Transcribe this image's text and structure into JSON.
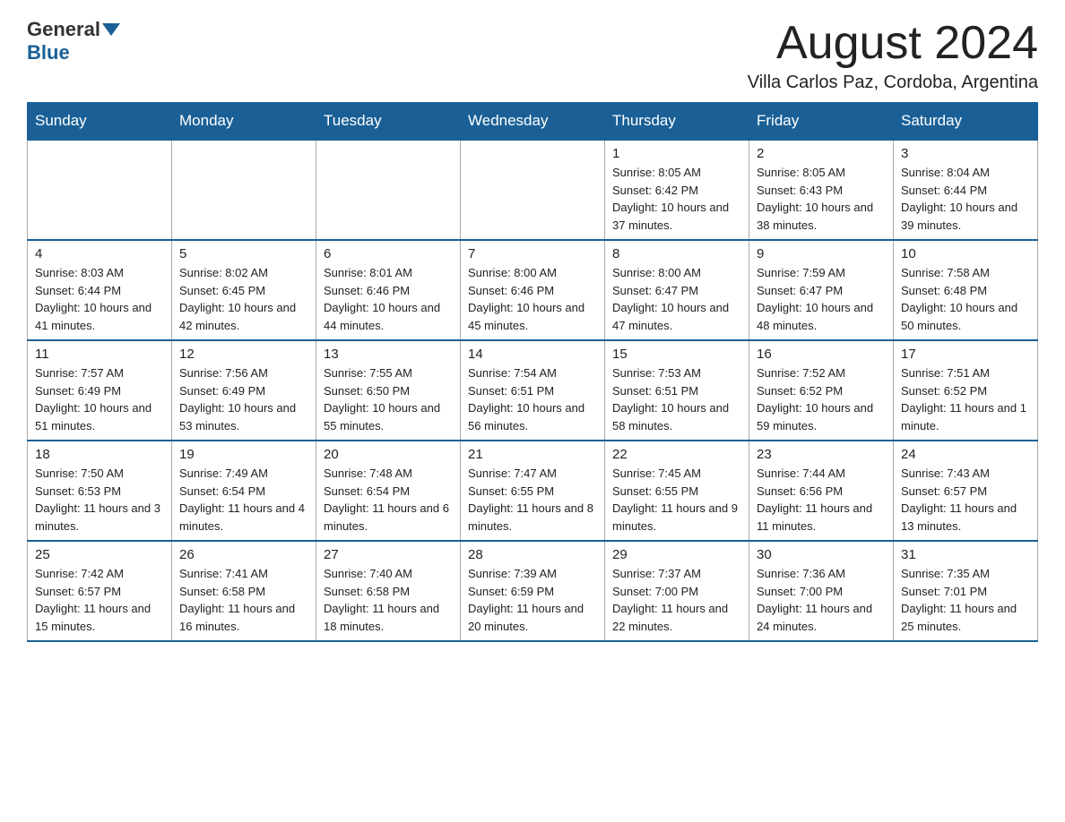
{
  "header": {
    "logo_general": "General",
    "logo_blue": "Blue",
    "month_title": "August 2024",
    "location": "Villa Carlos Paz, Cordoba, Argentina"
  },
  "days_of_week": [
    "Sunday",
    "Monday",
    "Tuesday",
    "Wednesday",
    "Thursday",
    "Friday",
    "Saturday"
  ],
  "weeks": [
    {
      "days": [
        {
          "num": "",
          "info": ""
        },
        {
          "num": "",
          "info": ""
        },
        {
          "num": "",
          "info": ""
        },
        {
          "num": "",
          "info": ""
        },
        {
          "num": "1",
          "info": "Sunrise: 8:05 AM\nSunset: 6:42 PM\nDaylight: 10 hours and 37 minutes."
        },
        {
          "num": "2",
          "info": "Sunrise: 8:05 AM\nSunset: 6:43 PM\nDaylight: 10 hours and 38 minutes."
        },
        {
          "num": "3",
          "info": "Sunrise: 8:04 AM\nSunset: 6:44 PM\nDaylight: 10 hours and 39 minutes."
        }
      ]
    },
    {
      "days": [
        {
          "num": "4",
          "info": "Sunrise: 8:03 AM\nSunset: 6:44 PM\nDaylight: 10 hours and 41 minutes."
        },
        {
          "num": "5",
          "info": "Sunrise: 8:02 AM\nSunset: 6:45 PM\nDaylight: 10 hours and 42 minutes."
        },
        {
          "num": "6",
          "info": "Sunrise: 8:01 AM\nSunset: 6:46 PM\nDaylight: 10 hours and 44 minutes."
        },
        {
          "num": "7",
          "info": "Sunrise: 8:00 AM\nSunset: 6:46 PM\nDaylight: 10 hours and 45 minutes."
        },
        {
          "num": "8",
          "info": "Sunrise: 8:00 AM\nSunset: 6:47 PM\nDaylight: 10 hours and 47 minutes."
        },
        {
          "num": "9",
          "info": "Sunrise: 7:59 AM\nSunset: 6:47 PM\nDaylight: 10 hours and 48 minutes."
        },
        {
          "num": "10",
          "info": "Sunrise: 7:58 AM\nSunset: 6:48 PM\nDaylight: 10 hours and 50 minutes."
        }
      ]
    },
    {
      "days": [
        {
          "num": "11",
          "info": "Sunrise: 7:57 AM\nSunset: 6:49 PM\nDaylight: 10 hours and 51 minutes."
        },
        {
          "num": "12",
          "info": "Sunrise: 7:56 AM\nSunset: 6:49 PM\nDaylight: 10 hours and 53 minutes."
        },
        {
          "num": "13",
          "info": "Sunrise: 7:55 AM\nSunset: 6:50 PM\nDaylight: 10 hours and 55 minutes."
        },
        {
          "num": "14",
          "info": "Sunrise: 7:54 AM\nSunset: 6:51 PM\nDaylight: 10 hours and 56 minutes."
        },
        {
          "num": "15",
          "info": "Sunrise: 7:53 AM\nSunset: 6:51 PM\nDaylight: 10 hours and 58 minutes."
        },
        {
          "num": "16",
          "info": "Sunrise: 7:52 AM\nSunset: 6:52 PM\nDaylight: 10 hours and 59 minutes."
        },
        {
          "num": "17",
          "info": "Sunrise: 7:51 AM\nSunset: 6:52 PM\nDaylight: 11 hours and 1 minute."
        }
      ]
    },
    {
      "days": [
        {
          "num": "18",
          "info": "Sunrise: 7:50 AM\nSunset: 6:53 PM\nDaylight: 11 hours and 3 minutes."
        },
        {
          "num": "19",
          "info": "Sunrise: 7:49 AM\nSunset: 6:54 PM\nDaylight: 11 hours and 4 minutes."
        },
        {
          "num": "20",
          "info": "Sunrise: 7:48 AM\nSunset: 6:54 PM\nDaylight: 11 hours and 6 minutes."
        },
        {
          "num": "21",
          "info": "Sunrise: 7:47 AM\nSunset: 6:55 PM\nDaylight: 11 hours and 8 minutes."
        },
        {
          "num": "22",
          "info": "Sunrise: 7:45 AM\nSunset: 6:55 PM\nDaylight: 11 hours and 9 minutes."
        },
        {
          "num": "23",
          "info": "Sunrise: 7:44 AM\nSunset: 6:56 PM\nDaylight: 11 hours and 11 minutes."
        },
        {
          "num": "24",
          "info": "Sunrise: 7:43 AM\nSunset: 6:57 PM\nDaylight: 11 hours and 13 minutes."
        }
      ]
    },
    {
      "days": [
        {
          "num": "25",
          "info": "Sunrise: 7:42 AM\nSunset: 6:57 PM\nDaylight: 11 hours and 15 minutes."
        },
        {
          "num": "26",
          "info": "Sunrise: 7:41 AM\nSunset: 6:58 PM\nDaylight: 11 hours and 16 minutes."
        },
        {
          "num": "27",
          "info": "Sunrise: 7:40 AM\nSunset: 6:58 PM\nDaylight: 11 hours and 18 minutes."
        },
        {
          "num": "28",
          "info": "Sunrise: 7:39 AM\nSunset: 6:59 PM\nDaylight: 11 hours and 20 minutes."
        },
        {
          "num": "29",
          "info": "Sunrise: 7:37 AM\nSunset: 7:00 PM\nDaylight: 11 hours and 22 minutes."
        },
        {
          "num": "30",
          "info": "Sunrise: 7:36 AM\nSunset: 7:00 PM\nDaylight: 11 hours and 24 minutes."
        },
        {
          "num": "31",
          "info": "Sunrise: 7:35 AM\nSunset: 7:01 PM\nDaylight: 11 hours and 25 minutes."
        }
      ]
    }
  ]
}
